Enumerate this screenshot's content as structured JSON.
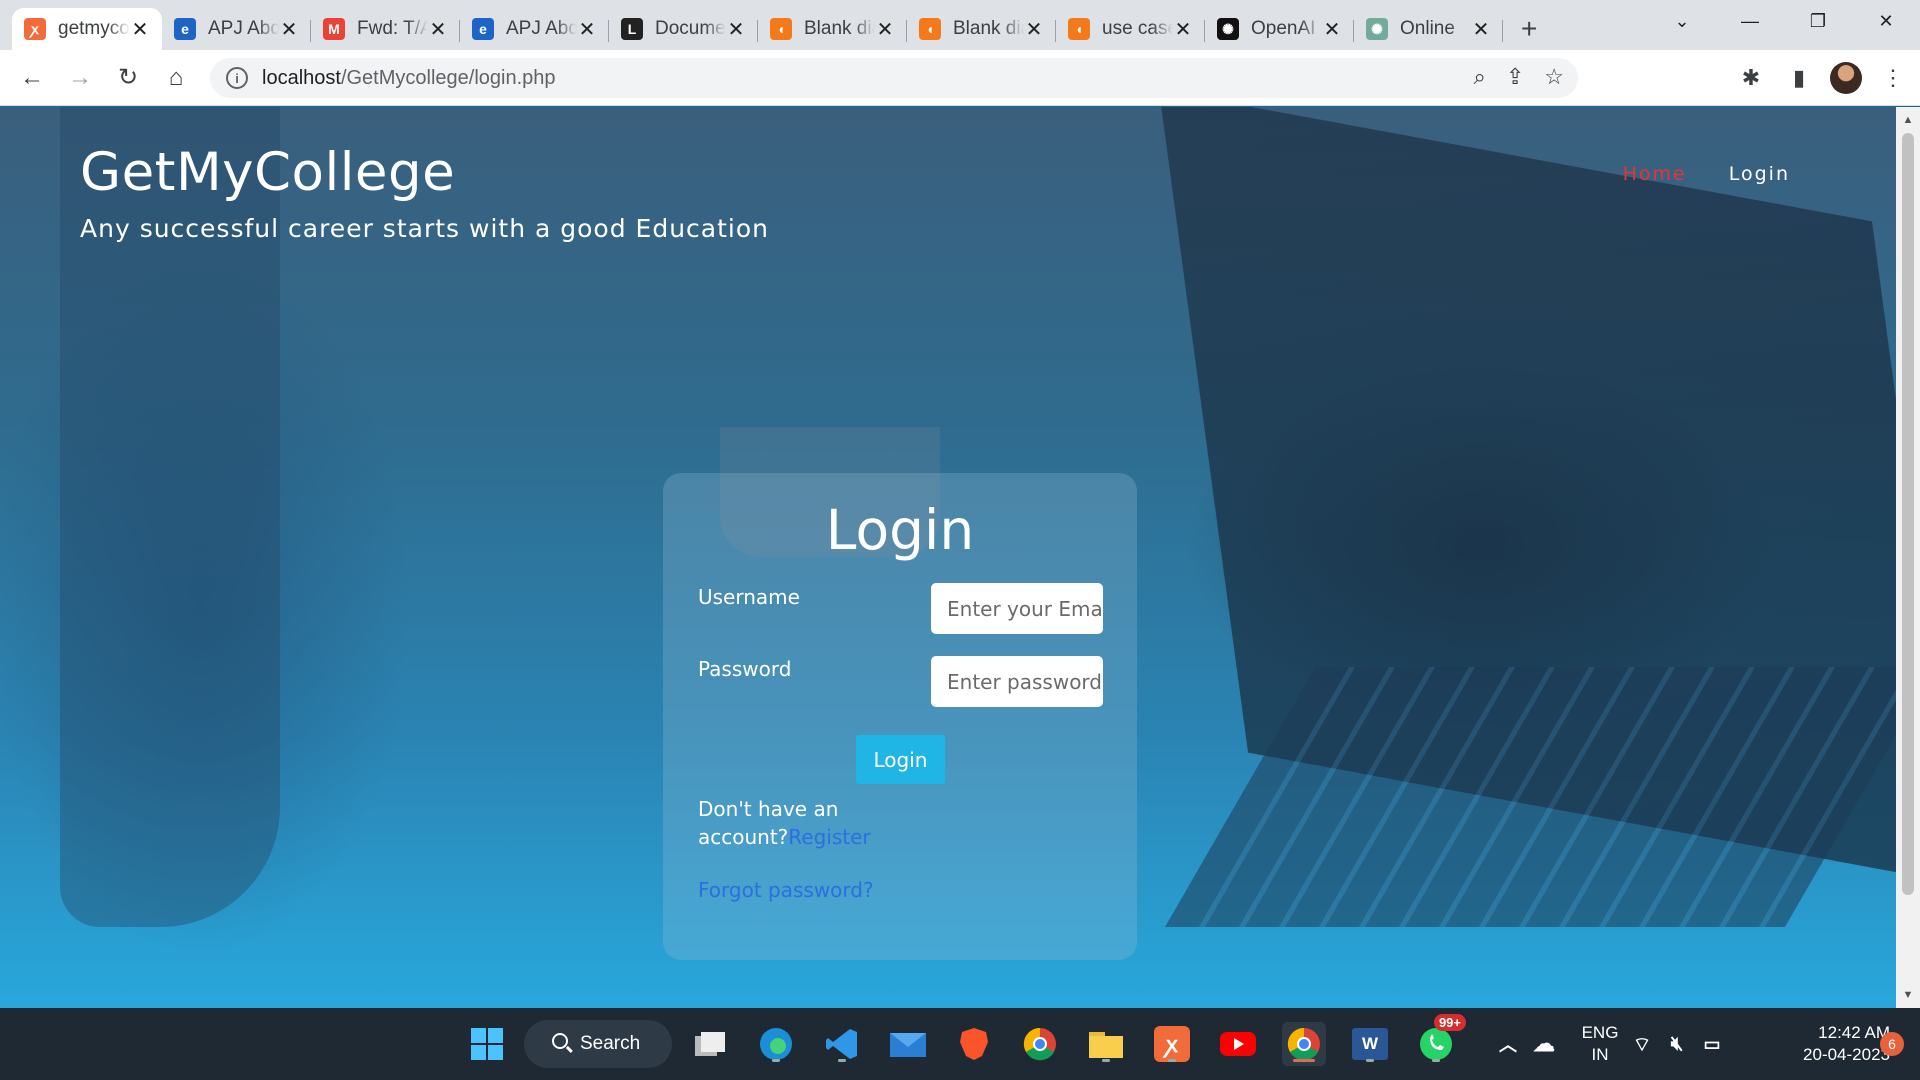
{
  "browser": {
    "tabs": [
      {
        "title": "getmycollege",
        "icon": "xampp-icon",
        "color": "#f26b3a",
        "active": true
      },
      {
        "title": "APJ Abdul Kalam",
        "icon": "edge-ie-icon",
        "color": "#1e63c6"
      },
      {
        "title": "Fwd: T/A",
        "icon": "gmail-icon",
        "color": "#ea4335"
      },
      {
        "title": "APJ Abdul Kalam",
        "icon": "edge-ie-icon",
        "color": "#1e63c6"
      },
      {
        "title": "Document",
        "icon": "document-icon",
        "color": "#222222"
      },
      {
        "title": "Blank diagram",
        "icon": "lucidchart-icon",
        "color": "#f27a1a"
      },
      {
        "title": "Blank diagram",
        "icon": "lucidchart-icon",
        "color": "#f27a1a"
      },
      {
        "title": "use case",
        "icon": "lucidchart-icon",
        "color": "#f27a1a"
      },
      {
        "title": "OpenAI",
        "icon": "openai-icon",
        "color": "#111111"
      },
      {
        "title": "Online",
        "icon": "chatgpt-icon",
        "color": "#74aa9c"
      }
    ],
    "url_host": "localhost",
    "url_path": "/GetMycollege/login.php"
  },
  "site": {
    "brand": "GetMyCollege",
    "tagline": "Any successful career starts with a good Education",
    "nav": {
      "home": "Home",
      "login": "Login"
    }
  },
  "login_form": {
    "heading": "Login",
    "username_label": "Username",
    "username_placeholder": "Enter your Email",
    "password_label": "Password",
    "password_placeholder": "Enter password",
    "submit_label": "Login",
    "register_prompt": "Don't have an account?",
    "register_link": "Register",
    "forgot_link": "Forgot password?"
  },
  "taskbar": {
    "search_label": "Search",
    "whatsapp_badge": "99+",
    "lang_line1": "ENG",
    "lang_line2": "IN",
    "time": "12:42 AM",
    "date": "20-04-2023",
    "notifications": "6"
  }
}
